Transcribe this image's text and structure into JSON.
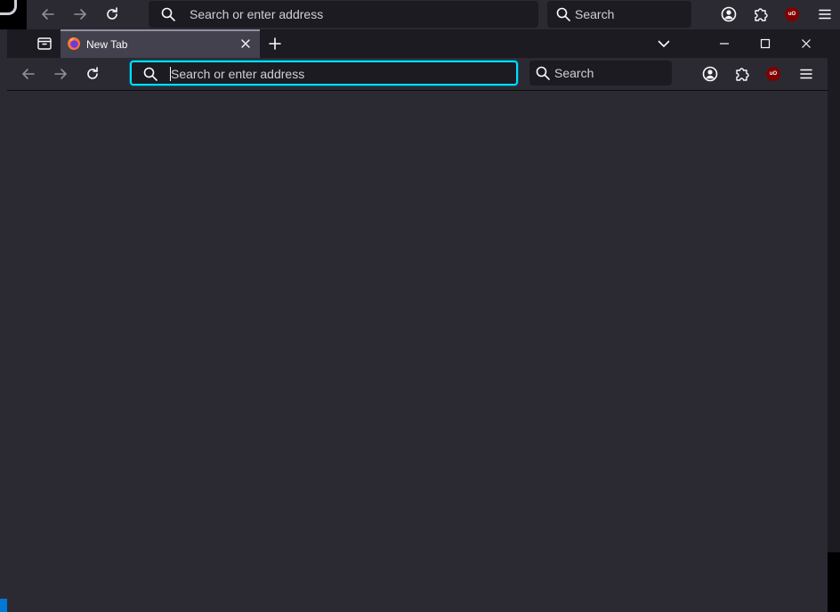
{
  "background_window": {
    "urlbar": {
      "placeholder": "Search or enter address"
    },
    "searchbar": {
      "placeholder": "Search"
    },
    "ublock_badge": "uO"
  },
  "foreground_window": {
    "tabs": [
      {
        "label": "New Tab",
        "favicon": "firefox-icon",
        "active": true
      }
    ],
    "urlbar": {
      "placeholder": "Search or enter address",
      "focused": true
    },
    "searchbar": {
      "placeholder": "Search"
    },
    "ublock_badge": "uO"
  },
  "colors": {
    "accent_focus": "#00ddff",
    "toolbar": "#2b2a33",
    "frame": "#1c1b22",
    "ublock": "#800000"
  },
  "icons": {
    "nav": [
      "back-icon",
      "forward-icon",
      "reload-icon"
    ],
    "toolbar_right": [
      "account-icon",
      "extensions-icon",
      "ublock-icon",
      "menu-icon"
    ],
    "window_controls": [
      "minimize-icon",
      "maximize-icon",
      "close-icon"
    ]
  }
}
